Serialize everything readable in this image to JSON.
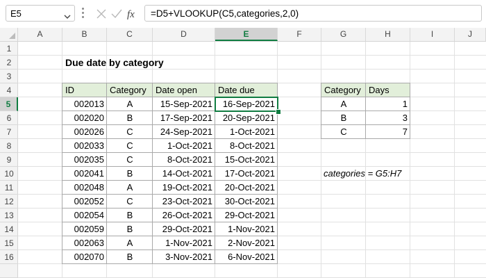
{
  "namebox": {
    "value": "E5"
  },
  "formula_bar": {
    "formula": "=D5+VLOOKUP(C5,categories,2,0)",
    "fx": "fx"
  },
  "columns": [
    "A",
    "B",
    "C",
    "D",
    "E",
    "F",
    "G",
    "H",
    "I",
    "J"
  ],
  "rows": [
    "1",
    "2",
    "3",
    "4",
    "5",
    "6",
    "7",
    "8",
    "9",
    "10",
    "11",
    "12",
    "13",
    "14",
    "15",
    "16"
  ],
  "title": "Due date by category",
  "main_table": {
    "headers": [
      "ID",
      "Category",
      "Date open",
      "Date due"
    ],
    "rows": [
      [
        "002013",
        "A",
        "15-Sep-2021",
        "16-Sep-2021"
      ],
      [
        "002020",
        "B",
        "17-Sep-2021",
        "20-Sep-2021"
      ],
      [
        "002026",
        "C",
        "24-Sep-2021",
        "1-Oct-2021"
      ],
      [
        "002033",
        "C",
        "1-Oct-2021",
        "8-Oct-2021"
      ],
      [
        "002035",
        "C",
        "8-Oct-2021",
        "15-Oct-2021"
      ],
      [
        "002041",
        "B",
        "14-Oct-2021",
        "17-Oct-2021"
      ],
      [
        "002048",
        "A",
        "19-Oct-2021",
        "20-Oct-2021"
      ],
      [
        "002052",
        "C",
        "23-Oct-2021",
        "30-Oct-2021"
      ],
      [
        "002054",
        "B",
        "26-Oct-2021",
        "29-Oct-2021"
      ],
      [
        "002059",
        "B",
        "29-Oct-2021",
        "1-Nov-2021"
      ],
      [
        "002063",
        "A",
        "1-Nov-2021",
        "2-Nov-2021"
      ],
      [
        "002070",
        "B",
        "3-Nov-2021",
        "6-Nov-2021"
      ]
    ]
  },
  "lookup_table": {
    "headers": [
      "Category",
      "Days"
    ],
    "rows": [
      [
        "A",
        "1"
      ],
      [
        "B",
        "3"
      ],
      [
        "C",
        "7"
      ]
    ]
  },
  "note": "categories = G5:H7",
  "colors": {
    "header_fill": "#e2efda",
    "accent": "#107c41"
  }
}
